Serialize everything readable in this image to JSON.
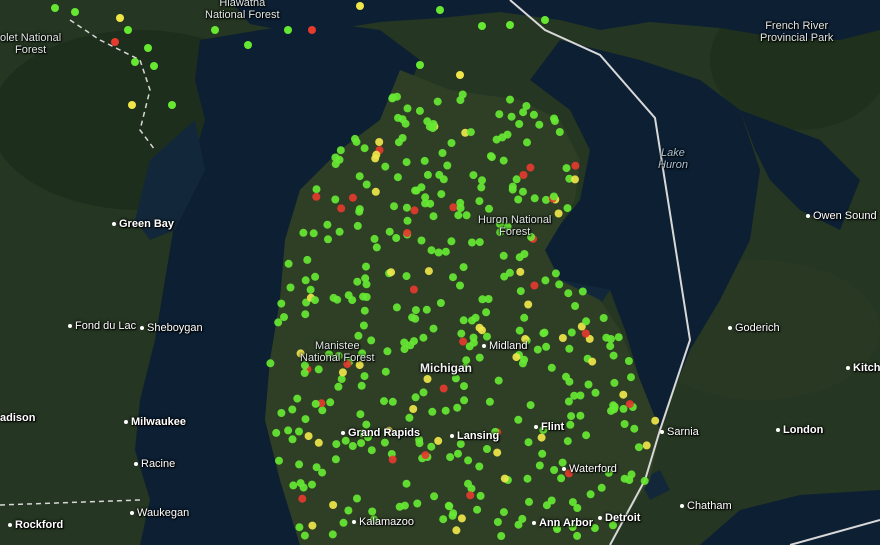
{
  "colors": {
    "water": "#0d1f33",
    "land": "#253622",
    "land_dark": "#1c2b1a",
    "border": "#d8d8d8",
    "status_green": "#66e833",
    "status_yellow": "#f0e64a",
    "status_red": "#e53a2c"
  },
  "labels": {
    "hiawatha": "Hiawatha\nNational Forest",
    "ottawa": "olet National\nForest",
    "french_river": "French River\nProvincial Park",
    "lake_huron": "Lake\nHuron",
    "green_bay": "Green Bay",
    "owen_sound": "Owen Sound",
    "huron_nf": "Huron National\nForest",
    "fond_du_lac": "Fond du Lac",
    "sheboygan": "Sheboygan",
    "goderich": "Goderich",
    "midland": "Midland",
    "manistee": "Manistee\nNational Forest",
    "michigan": "Michigan",
    "kitch": "Kitch",
    "madison": "adison",
    "milwaukee": "Milwaukee",
    "flint": "Flint",
    "sarnia": "Sarnia",
    "london": "London",
    "grand_rapids": "Grand Rapids",
    "racine": "Racine",
    "lansing": "Lansing",
    "waterford": "Waterford",
    "chatham": "Chatham",
    "waukegan": "Waukegan",
    "rockford": "Rockford",
    "kalamazoo": "Kalamazoo",
    "ann_arbor": "Ann Arbor",
    "detroit": "Detroit"
  }
}
